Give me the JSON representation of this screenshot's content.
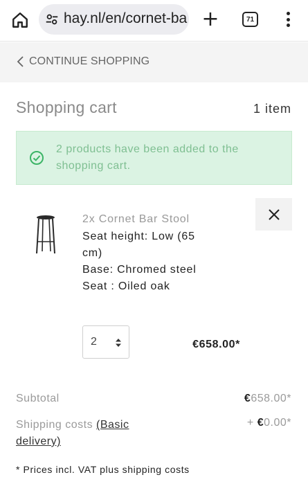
{
  "browser": {
    "url": "hay.nl/en/cornet-ba",
    "tab_count": "71",
    "icons": {
      "home": "home-icon",
      "site_info": "tune-icon",
      "new_tab": "plus-icon",
      "tabs": "tabs-icon",
      "menu": "kebab-menu-icon"
    }
  },
  "nav": {
    "continue_label": "CONTINUE SHOPPING"
  },
  "cart": {
    "title": "Shopping cart",
    "count": "1 item",
    "alert": {
      "text": "2 products have been added to the shopping cart.",
      "color": "#dbf3e3",
      "text_color": "#7fbf92"
    },
    "items": [
      {
        "name": "2x Cornet Bar Stool",
        "attributes": [
          "Seat height: Low (65 cm)",
          "Base: Chromed steel",
          "Seat : Oiled oak"
        ],
        "quantity": "2",
        "price": "€658.00*"
      }
    ],
    "subtotal_label": "Subtotal",
    "subtotal_currency": "€",
    "subtotal_value": "658.00*",
    "shipping_label": "Shipping costs",
    "shipping_link": "(Basic delivery)",
    "shipping_prefix": "+",
    "shipping_currency": "€",
    "shipping_value": "0.00*",
    "vat_note": "* Prices incl. VAT plus shipping costs"
  }
}
